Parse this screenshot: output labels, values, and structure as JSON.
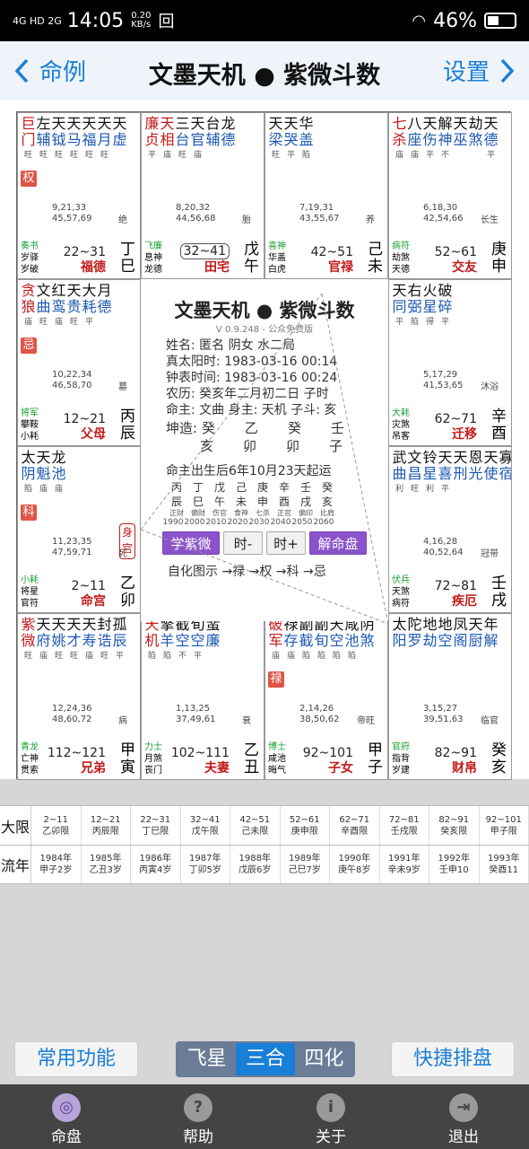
{
  "status": {
    "signal": "4G HD 2G",
    "time": "14:05",
    "speed_top": "0.20",
    "speed_unit": "KB/s",
    "extra_icon": "回",
    "battery": "46%"
  },
  "header": {
    "back_label": "命例",
    "title": "文墨天机 ● 紫微斗数",
    "settings_label": "设置"
  },
  "cells": [
    {
      "stars": [
        [
          "巨",
          "旺",
          "red"
        ],
        [
          "左",
          "旺",
          ""
        ],
        [
          "天",
          "旺",
          ""
        ],
        [
          "天",
          "旺",
          ""
        ],
        [
          "天",
          "旺",
          ""
        ],
        [
          "天",
          "旺",
          ""
        ],
        [
          "天",
          "",
          ""
        ]
      ],
      "stars_b": [
        "门",
        "辅",
        "钺",
        "马",
        "福",
        "月",
        "虚"
      ],
      "tag": "权",
      "nums": "9,21,33\n45,57,69",
      "cs": "绝",
      "bl": [
        "奏书",
        "岁驿",
        "岁破"
      ],
      "range": "22~31",
      "palace": "福德",
      "gz": [
        "丁",
        "巳"
      ]
    },
    {
      "stars": [
        [
          "廉",
          "平",
          "red"
        ],
        [
          "天",
          "庙",
          "red"
        ],
        [
          "三",
          "旺",
          ""
        ],
        [
          "天",
          "庙",
          ""
        ],
        [
          "台",
          ""
        ],
        [
          "龙",
          ""
        ]
      ],
      "stars_b": [
        "贞",
        "相",
        "台",
        "官",
        "辅",
        "德"
      ],
      "tag": "",
      "nums": "8,20,32\n44,56,68",
      "cs": "胎",
      "bl": [
        "飞廉",
        "息神",
        "龙德"
      ],
      "range": "32~41",
      "palace": "田宅",
      "gz": [
        "戊",
        "午"
      ]
    },
    {
      "stars": [
        [
          "天",
          "旺",
          ""
        ],
        [
          "天",
          "平",
          ""
        ],
        [
          "华",
          "陷",
          ""
        ]
      ],
      "stars_b": [
        "梁",
        "哭",
        "盖"
      ],
      "tag": "",
      "nums": "7,19,31\n43,55,67",
      "cs": "养",
      "bl": [
        "喜神",
        "华盖",
        "白虎"
      ],
      "range": "42~51",
      "palace": "官禄",
      "gz": [
        "己",
        "未"
      ]
    },
    {
      "stars": [
        [
          "七",
          "庙",
          "red"
        ],
        [
          "八",
          "庙",
          ""
        ],
        [
          "天",
          "平",
          ""
        ],
        [
          "解",
          "不",
          ""
        ],
        [
          "天",
          "",
          ""
        ],
        [
          "劫",
          "",
          ""
        ],
        [
          "天",
          "平",
          ""
        ]
      ],
      "stars_b": [
        "杀",
        "座",
        "伤",
        "神",
        "巫",
        "煞",
        "德"
      ],
      "tag": "",
      "nums": "6,18,30\n42,54,66",
      "cs": "长生",
      "bl": [
        "病符",
        "劫煞",
        "天德"
      ],
      "range": "52~61",
      "palace": "交友",
      "gz": [
        "庚",
        "申"
      ]
    },
    {
      "stars": [
        [
          "贪",
          "庙",
          "red"
        ],
        [
          "文",
          "旺",
          ""
        ],
        [
          "红",
          "庙",
          ""
        ],
        [
          "天",
          "旺",
          ""
        ],
        [
          "大",
          "平",
          ""
        ],
        [
          "月",
          "",
          ""
        ]
      ],
      "stars_b": [
        "狼",
        "曲",
        "鸾",
        "贵",
        "耗",
        "德"
      ],
      "tag": "忌",
      "nums": "10,22,34\n46,58,70",
      "cs": "墓",
      "bl": [
        "将军",
        "攀鞍",
        "小耗"
      ],
      "range": "12~21",
      "palace": "父母",
      "gz": [
        "丙",
        "辰"
      ]
    },
    {
      "stars": [
        [
          "天",
          "平",
          ""
        ],
        [
          "右",
          "陷",
          ""
        ],
        [
          "火",
          "得",
          ""
        ],
        [
          "破",
          "平",
          ""
        ]
      ],
      "stars_b": [
        "同",
        "弼",
        "星",
        "碎"
      ],
      "tag": "",
      "nums": "5,17,29\n41,53,65",
      "cs": "沐浴",
      "bl": [
        "大耗",
        "灾煞",
        "吊客"
      ],
      "range": "62~71",
      "palace": "迁移",
      "gz": [
        "辛",
        "酉"
      ]
    },
    {
      "stars": [
        [
          "太",
          "陷",
          ""
        ],
        [
          "天",
          "庙",
          ""
        ],
        [
          "龙",
          "庙",
          ""
        ]
      ],
      "stars_b": [
        "阴",
        "魁",
        "池"
      ],
      "tag": "科",
      "nums": "11,23,35\n47,59,71",
      "cs": "死",
      "bl": [
        "小耗",
        "将星",
        "官符"
      ],
      "range": "2~11",
      "palace": "命宫",
      "gz": [
        "乙",
        "卯"
      ]
    },
    {
      "stars": [
        [
          "武",
          "利",
          ""
        ],
        [
          "文",
          "旺",
          ""
        ],
        [
          "铃",
          "利",
          ""
        ],
        [
          "天",
          "平",
          ""
        ],
        [
          "天",
          "",
          ""
        ],
        [
          "恩",
          "",
          ""
        ],
        [
          "天",
          "",
          ""
        ],
        [
          "寡",
          "",
          ""
        ]
      ],
      "stars_b": [
        "曲",
        "昌",
        "星",
        "喜",
        "刑",
        "光",
        "使",
        "宿"
      ],
      "tag": "",
      "nums": "4,16,28\n40,52,64",
      "cs": "冠带",
      "bl": [
        "伏兵",
        "天煞",
        "病符"
      ],
      "range": "72~81",
      "palace": "疾厄",
      "gz": [
        "壬",
        "戌"
      ]
    },
    {
      "stars": [
        [
          "紫",
          "旺",
          "red"
        ],
        [
          "天",
          "庙",
          ""
        ],
        [
          "天",
          "旺",
          ""
        ],
        [
          "天",
          "旺",
          ""
        ],
        [
          "天",
          "庙",
          ""
        ],
        [
          "封",
          "旺",
          ""
        ],
        [
          "孤",
          "平",
          ""
        ]
      ],
      "stars_b": [
        "微",
        "府",
        "姚",
        "才",
        "寿",
        "诰",
        "辰"
      ],
      "tag": "",
      "nums": "12,24,36\n48,60,72",
      "cs": "病",
      "bl": [
        "青龙",
        "亡神",
        "贯索"
      ],
      "range": "112~121",
      "palace": "兄弟",
      "gz": [
        "甲",
        "寅"
      ]
    },
    {
      "stars": [
        [
          "天",
          "陷",
          "red"
        ],
        [
          "擎",
          "陷",
          ""
        ],
        [
          "截",
          "不",
          ""
        ],
        [
          "旬",
          "平",
          ""
        ],
        [
          "蜚",
          "",
          ""
        ]
      ],
      "stars_b": [
        "机",
        "羊",
        "空",
        "空",
        "廉"
      ],
      "tag": "",
      "nums": "1,13,25\n37,49,61",
      "cs": "衰",
      "bl": [
        "力士",
        "月煞",
        "丧门"
      ],
      "range": "102~111",
      "palace": "夫妻",
      "gz": [
        "乙",
        "丑"
      ]
    },
    {
      "stars": [
        [
          "破",
          "庙",
          "red"
        ],
        [
          "禄",
          "庙",
          ""
        ],
        [
          "副",
          "陷",
          ""
        ],
        [
          "副",
          "陷",
          ""
        ],
        [
          "天",
          "陷",
          ""
        ],
        [
          "咸",
          "陷",
          ""
        ],
        [
          "阴",
          "",
          ""
        ]
      ],
      "stars_b": [
        "军",
        "存",
        "截",
        "旬",
        "空",
        "池",
        "煞"
      ],
      "tag": "禄",
      "nums": "2,14,26\n38,50,62",
      "cs": "帝旺",
      "bl": [
        "博士",
        "咸池",
        "晦气"
      ],
      "range": "92~101",
      "palace": "子女",
      "gz": [
        "甲",
        "子"
      ]
    },
    {
      "stars": [
        [
          "太",
          "",
          ""
        ],
        [
          "陀",
          "",
          ""
        ],
        [
          "地",
          "",
          ""
        ],
        [
          "地",
          "",
          ""
        ],
        [
          "凤",
          "",
          ""
        ],
        [
          "天",
          "",
          ""
        ],
        [
          "年",
          "",
          ""
        ]
      ],
      "stars_b": [
        "阳",
        "罗",
        "劫",
        "空",
        "阁",
        "厨",
        "解"
      ],
      "tag": "",
      "nums": "3,15,27\n39,51,63",
      "cs": "临官",
      "bl": [
        "官府",
        "指背",
        "岁建"
      ],
      "range": "82~91",
      "palace": "财帛",
      "gz": [
        "癸",
        "亥"
      ]
    }
  ],
  "center": {
    "title": "文墨天机 ● 紫微斗数",
    "version": "V 0.9.248 - 公众免费版",
    "info": [
      "姓名: 匿名          阴女  水二局",
      "真太阳时: 1983-03-16  00:14",
      "钟表时间: 1983-03-16  00:24",
      "农历: 癸亥年二月初二日 子时",
      "命主: 文曲 身主: 天机 子斗: 亥"
    ],
    "pillar1": [
      "坤造:",
      "癸",
      "乙",
      "癸",
      "壬"
    ],
    "pillar2": [
      "亥",
      "卯",
      "卯",
      "子"
    ],
    "qiyun": "命主出生后6年10月23天起运",
    "gz_top": [
      "丙",
      "丁",
      "戊",
      "己",
      "庚",
      "辛",
      "壬",
      "癸"
    ],
    "gz_bot": [
      "辰",
      "巳",
      "午",
      "未",
      "申",
      "酉",
      "戌",
      "亥"
    ],
    "gz_sub": [
      "正财",
      "偏财",
      "伤官",
      "食神",
      "七杀",
      "正官",
      "偏印",
      "比肩"
    ],
    "gz_years": [
      "1990",
      "2000",
      "2010",
      "2020",
      "2030",
      "2040",
      "2050",
      "2060"
    ],
    "btn_learn": "学紫微",
    "btn_minus": "时-",
    "btn_plus": "时+",
    "btn_jie": "解命盘",
    "hua": "自化图示 →禄 →权 →科 →忌",
    "shen_gong": "身宫",
    "si": "死"
  },
  "table": {
    "row1_label": "大限",
    "row1": [
      [
        "2~11",
        "乙卯限"
      ],
      [
        "12~21",
        "丙辰限"
      ],
      [
        "22~31",
        "丁巳限"
      ],
      [
        "32~41",
        "戊午限"
      ],
      [
        "42~51",
        "己未限"
      ],
      [
        "52~61",
        "庚申限"
      ],
      [
        "62~71",
        "辛酉限"
      ],
      [
        "72~81",
        "壬戌限"
      ],
      [
        "82~91",
        "癸亥限"
      ],
      [
        "92~101",
        "甲子限"
      ]
    ],
    "row2_label": "流年",
    "row2": [
      [
        "1984年",
        "甲子2岁"
      ],
      [
        "1985年",
        "乙丑3岁"
      ],
      [
        "1986年",
        "丙寅4岁"
      ],
      [
        "1987年",
        "丁卯5岁"
      ],
      [
        "1988年",
        "戊辰6岁"
      ],
      [
        "1989年",
        "己巳7岁"
      ],
      [
        "1990年",
        "庚午8岁"
      ],
      [
        "1991年",
        "辛未9岁"
      ],
      [
        "1992年",
        "壬申10"
      ],
      [
        "1993年",
        "癸酉11"
      ]
    ]
  },
  "buttons": {
    "common": "常用功能",
    "seg": [
      "飞星",
      "三合",
      "四化"
    ],
    "quick": "快捷排盘"
  },
  "tabs": [
    {
      "label": "命盘",
      "icon": "◎"
    },
    {
      "label": "帮助",
      "icon": "?"
    },
    {
      "label": "关于",
      "icon": "i"
    },
    {
      "label": "退出",
      "icon": "⇥"
    }
  ]
}
